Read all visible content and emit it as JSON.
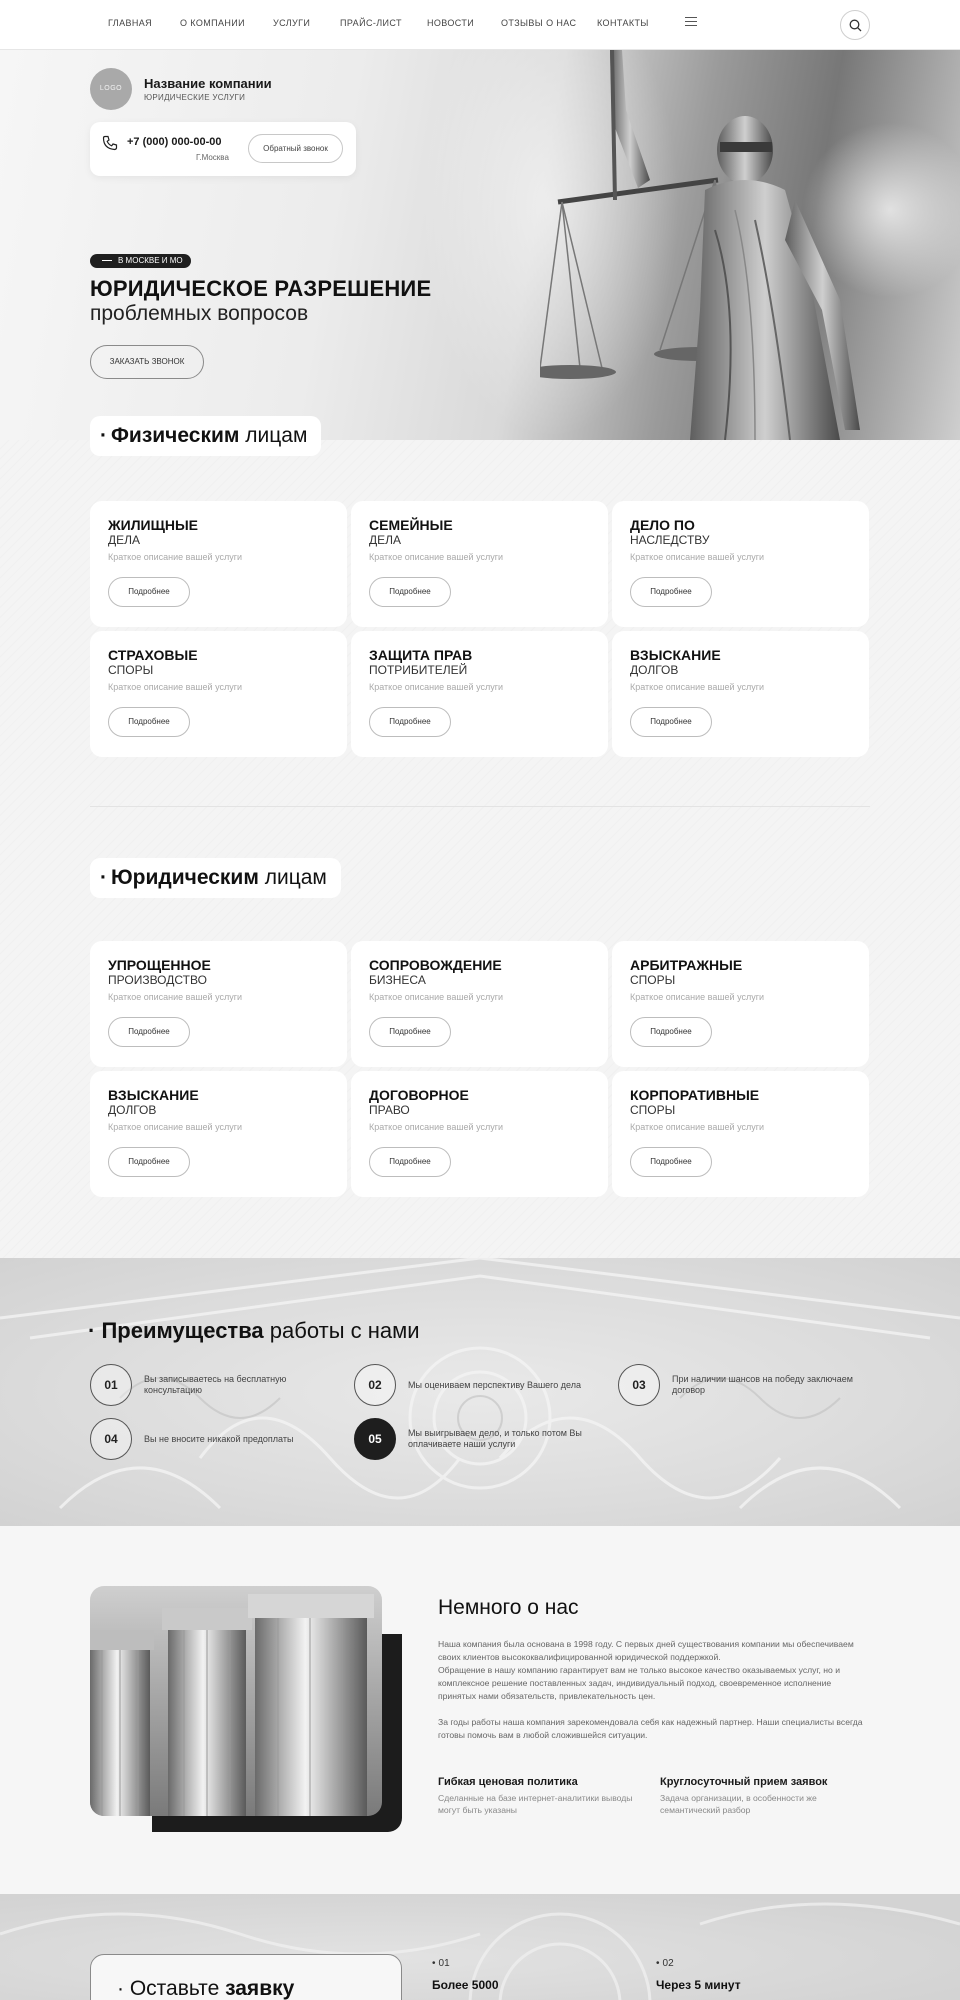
{
  "nav": {
    "items": [
      "ГЛАВНАЯ",
      "О КОМПАНИИ",
      "УСЛУГИ",
      "ПРАЙС-ЛИСТ",
      "НОВОСТИ",
      "ОТЗЫВЫ О НАС",
      "КОНТАКТЫ"
    ],
    "menu_icon": "hamburger-icon",
    "search_icon": "search-icon"
  },
  "brand": {
    "logo_text": "LOGO",
    "name": "Название компании",
    "subtitle": "ЮРИДИЧЕСКИЕ УСЛУГИ"
  },
  "contact": {
    "phone": "+7 (000) 000-00-00",
    "city": "Г.Москва",
    "callback_label": "Обратный звонок",
    "phone_icon": "phone-icon"
  },
  "hero": {
    "badge": "В МОСКВЕ И МО",
    "title_line1": "ЮРИДИЧЕСКОЕ РАЗРЕШЕНИЕ",
    "title_line2": "проблемных вопросов",
    "cta_label": "ЗАКАЗАТЬ ЗВОНОК"
  },
  "individuals": {
    "title_bold": "Физическим",
    "title_rest": "лицам",
    "cards": [
      {
        "title": "ЖИЛИЩНЫЕ",
        "subtitle": "ДЕЛА",
        "desc": "Краткое описание вашей услуги",
        "button": "Подробнее"
      },
      {
        "title": "СЕМЕЙНЫЕ",
        "subtitle": "ДЕЛА",
        "desc": "Краткое описание вашей услуги",
        "button": "Подробнее"
      },
      {
        "title": "ДЕЛО ПО",
        "subtitle": "НАСЛЕДСТВУ",
        "desc": "Краткое описание вашей услуги",
        "button": "Подробнее"
      },
      {
        "title": "СТРАХОВЫЕ",
        "subtitle": "СПОРЫ",
        "desc": "Краткое описание вашей услуги",
        "button": "Подробнее"
      },
      {
        "title": "ЗАЩИТА ПРАВ",
        "subtitle": "ПОТРИБИТЕЛЕЙ",
        "desc": "Краткое описание вашей услуги",
        "button": "Подробнее"
      },
      {
        "title": "ВЗЫСКАНИЕ",
        "subtitle": "ДОЛГОВ",
        "desc": "Краткое описание вашей услуги",
        "button": "Подробнее"
      }
    ]
  },
  "legal": {
    "title_bold": "Юридическим",
    "title_rest": "лицам",
    "cards": [
      {
        "title": "УПРОЩЕННОЕ",
        "subtitle": "ПРОИЗВОДСТВО",
        "desc": "Краткое описание вашей услуги",
        "button": "Подробнее"
      },
      {
        "title": "СОПРОВОЖДЕНИЕ",
        "subtitle": "БИЗНЕСА",
        "desc": "Краткое описание вашей услуги",
        "button": "Подробнее"
      },
      {
        "title": "АРБИТРАЖНЫЕ",
        "subtitle": "СПОРЫ",
        "desc": "Краткое описание вашей услуги",
        "button": "Подробнее"
      },
      {
        "title": "ВЗЫСКАНИЕ",
        "subtitle": "ДОЛГОВ",
        "desc": "Краткое описание вашей услуги",
        "button": "Подробнее"
      },
      {
        "title": "ДОГОВОРНОЕ",
        "subtitle": "ПРАВО",
        "desc": "Краткое описание вашей услуги",
        "button": "Подробнее"
      },
      {
        "title": "КОРПОРАТИВНЫЕ",
        "subtitle": "СПОРЫ",
        "desc": "Краткое описание вашей услуги",
        "button": "Подробнее"
      }
    ]
  },
  "advantages": {
    "title_bold": "Преимущества",
    "title_rest": "работы с нами",
    "items": [
      {
        "num": "01",
        "text": "Вы записываетесь на бесплатную консультацию",
        "highlighted": false
      },
      {
        "num": "02",
        "text": "Мы оцениваем перспективу Вашего дела",
        "highlighted": false
      },
      {
        "num": "03",
        "text": "При наличии шансов на победу заключаем договор",
        "highlighted": false
      },
      {
        "num": "04",
        "text": "Вы не вносите никакой предоплаты",
        "highlighted": false
      },
      {
        "num": "05",
        "text": "Мы выигрываем дело, и только потом Вы оплачиваете наши услуги",
        "highlighted": true
      }
    ]
  },
  "about": {
    "title": "Немного о нас",
    "p1": "Наша компания была основана в 1998 году. С первых дней существования компании мы обеспечиваем своих клиентов высококвалифицированной юридической поддержкой.",
    "p2": "Обращение в нашу компанию гарантирует вам не только высокое качество оказываемых услуг, но и комплексное решение поставленных задач, индивидуальный подход, своевременное исполнение принятых нами обязательств, привлекательность цен.",
    "p3": "За годы работы наша компания зарекомендовала себя как надежный партнер. Наши специалисты всегда готовы помочь вам в любой сложившейся ситуации.",
    "features": [
      {
        "title": "Гибкая ценовая политика",
        "desc": "Сделанные на базе интернет-аналитики выводы могут быть указаны"
      },
      {
        "title": "Круглосуточный прием заявок",
        "desc": "Задача организации, в особенности же семантический разбор"
      }
    ]
  },
  "request": {
    "title_rest": "Оставьте",
    "title_bold": "заявку"
  },
  "stats": [
    {
      "index": "01",
      "value": "Более 5000"
    },
    {
      "index": "02",
      "value": "Через 5 минут"
    }
  ],
  "colors": {
    "accent": "#1e1e1e",
    "text": "#1c1c1c",
    "muted": "#aaaaaa",
    "background": "#f3f3f3"
  }
}
